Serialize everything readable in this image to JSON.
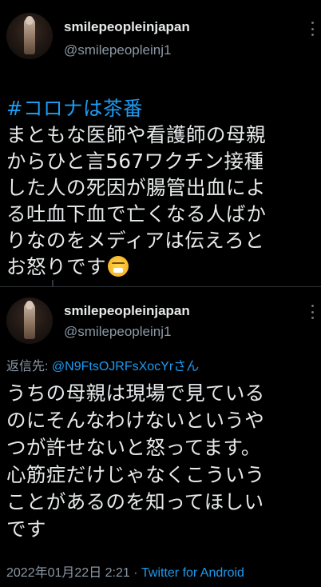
{
  "tweet1": {
    "display_name": "smilepeopleinjapan",
    "handle": "@smilepeopleinj1",
    "hashtag": "#コロナは茶番",
    "text": "まともな医師や看護師の母親\nからひと言567ワクチン接種\nした人の死因が腸管出血によ\nる吐血下血で亡くなる人ばか\nりなのをメディアは伝えろと\nお怒りです",
    "emoji": "face-with-steam-from-nose"
  },
  "tweet2": {
    "display_name": "smilepeopleinjapan",
    "handle": "@smilepeopleinj1",
    "reply_prefix": "返信先: ",
    "reply_to": "@N9FtsOJRFsXocYrさん",
    "text": "うちの母親は現場で見ている\nのにそんなわけないというや\nつが許せないと怒ってます。\n心筋症だけじゃなくこういう\nことがあるのを知ってほしい\nです",
    "timestamp": "2022年01月22日 2:21",
    "separator": " · ",
    "source": "Twitter for Android"
  },
  "colors": {
    "background": "#000000",
    "text": "#e7e9ea",
    "muted": "#8b98a5",
    "link": "#1d9bf0"
  }
}
